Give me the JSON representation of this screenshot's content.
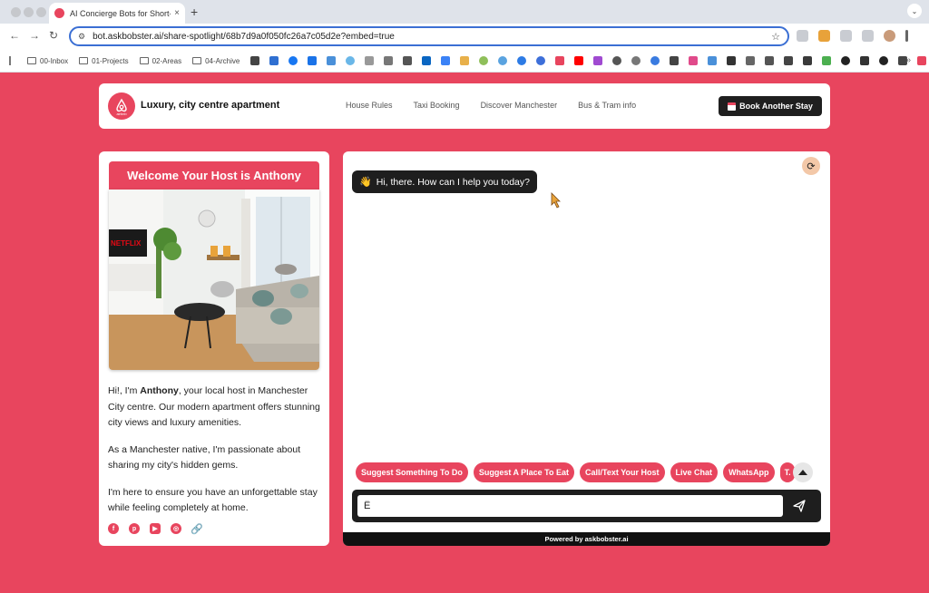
{
  "browser": {
    "tab_title": "AI Concierge Bots for Short-",
    "tab_close": "×",
    "new_tab": "+",
    "url": "bot.askbobster.ai/share-spotlight/68b7d9a0f050fc26a7c05d2e?embed=true",
    "bookmarks": {
      "folders": [
        "00-Inbox",
        "01-Projects",
        "02-Areas",
        "04-Archive"
      ],
      "more": "»"
    }
  },
  "header": {
    "title": "Luxury, city centre apartment",
    "nav": [
      "House Rules",
      "Taxi Booking",
      "Discover Manchester",
      "Bus & Tram info"
    ],
    "book_button": "Book Another Stay",
    "logo_text": "airbnb"
  },
  "host": {
    "welcome": "Welcome Your Host is Anthony",
    "bio_intro_pre": "Hi!, I'm ",
    "bio_name": "Anthony",
    "bio_intro_post": ", your local host in Manchester City centre. Our modern apartment offers stunning city views and luxury amenities.",
    "bio_p2": "As a Manchester native, I'm passionate about sharing my city's hidden gems.",
    "bio_p3": "I'm here to ensure you have an unforgettable stay while feeling completely at home.",
    "social_icons": [
      "facebook-icon",
      "pinterest-icon",
      "youtube-icon",
      "globe-icon",
      "link-icon"
    ],
    "tv_text": "NETFLIX"
  },
  "chat": {
    "greeting": "Hi, there. How can I help you today?",
    "suggestions": [
      "Suggest Something To Do",
      "Suggest A Place To Eat",
      "Call/Text Your Host",
      "Live Chat",
      "WhatsApp",
      "T."
    ],
    "input_value": "Ë",
    "powered_by": "Powered by askbobster.ai"
  },
  "colors": {
    "brand": "#e8455e",
    "dark": "#1e1e1e"
  }
}
